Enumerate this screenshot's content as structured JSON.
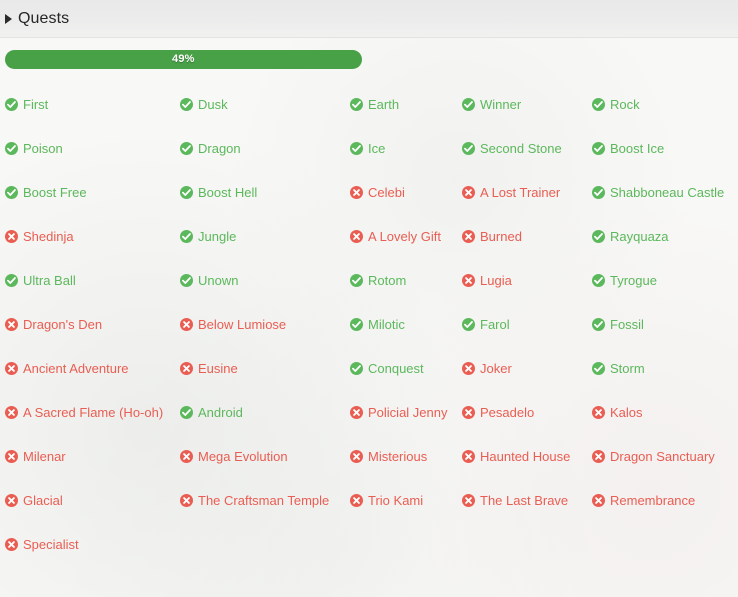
{
  "header": {
    "title": "Quests",
    "caret_icon": "caret-right-icon"
  },
  "progress": {
    "label": "49%",
    "percent": 49,
    "fill_color": "#49a147",
    "text_color": "#ffffff"
  },
  "legend": {
    "done_icon": "check-circle-icon",
    "todo_icon": "times-circle-icon",
    "done_color": "#5cb85c",
    "todo_color": "#ea5d52"
  },
  "quests": [
    {
      "label": "First",
      "status": "done"
    },
    {
      "label": "Dusk",
      "status": "done"
    },
    {
      "label": "Earth",
      "status": "done"
    },
    {
      "label": "Winner",
      "status": "done"
    },
    {
      "label": "Rock",
      "status": "done"
    },
    {
      "label": "Poison",
      "status": "done"
    },
    {
      "label": "Dragon",
      "status": "done"
    },
    {
      "label": "Ice",
      "status": "done"
    },
    {
      "label": "Second Stone",
      "status": "done"
    },
    {
      "label": "Boost Ice",
      "status": "done"
    },
    {
      "label": "Boost Free",
      "status": "done"
    },
    {
      "label": "Boost Hell",
      "status": "done"
    },
    {
      "label": "Celebi",
      "status": "todo"
    },
    {
      "label": "A Lost Trainer",
      "status": "todo"
    },
    {
      "label": "Shabboneau Castle",
      "status": "done"
    },
    {
      "label": "Shedinja",
      "status": "todo"
    },
    {
      "label": "Jungle",
      "status": "done"
    },
    {
      "label": "A Lovely Gift",
      "status": "todo"
    },
    {
      "label": "Burned",
      "status": "todo"
    },
    {
      "label": "Rayquaza",
      "status": "done"
    },
    {
      "label": "Ultra Ball",
      "status": "done"
    },
    {
      "label": "Unown",
      "status": "done"
    },
    {
      "label": "Rotom",
      "status": "done"
    },
    {
      "label": "Lugia",
      "status": "todo"
    },
    {
      "label": "Tyrogue",
      "status": "done"
    },
    {
      "label": "Dragon's Den",
      "status": "todo"
    },
    {
      "label": "Below Lumiose",
      "status": "todo"
    },
    {
      "label": "Milotic",
      "status": "done"
    },
    {
      "label": "Farol",
      "status": "done"
    },
    {
      "label": "Fossil",
      "status": "done"
    },
    {
      "label": "Ancient Adventure",
      "status": "todo"
    },
    {
      "label": "Eusine",
      "status": "todo"
    },
    {
      "label": "Conquest",
      "status": "done"
    },
    {
      "label": "Joker",
      "status": "todo"
    },
    {
      "label": "Storm",
      "status": "done"
    },
    {
      "label": "A Sacred Flame (Ho-oh)",
      "status": "todo"
    },
    {
      "label": "Android",
      "status": "done"
    },
    {
      "label": "Policial Jenny",
      "status": "todo"
    },
    {
      "label": "Pesadelo",
      "status": "todo"
    },
    {
      "label": "Kalos",
      "status": "todo"
    },
    {
      "label": "Milenar",
      "status": "todo"
    },
    {
      "label": "Mega Evolution",
      "status": "todo"
    },
    {
      "label": "Misterious",
      "status": "todo"
    },
    {
      "label": "Haunted House",
      "status": "todo"
    },
    {
      "label": "Dragon Sanctuary",
      "status": "todo"
    },
    {
      "label": "Glacial",
      "status": "todo"
    },
    {
      "label": "The Craftsman Temple",
      "status": "todo"
    },
    {
      "label": "Trio Kami",
      "status": "todo"
    },
    {
      "label": "The Last Brave",
      "status": "todo"
    },
    {
      "label": "Remembrance",
      "status": "todo"
    },
    {
      "label": "Specialist",
      "status": "todo"
    }
  ]
}
